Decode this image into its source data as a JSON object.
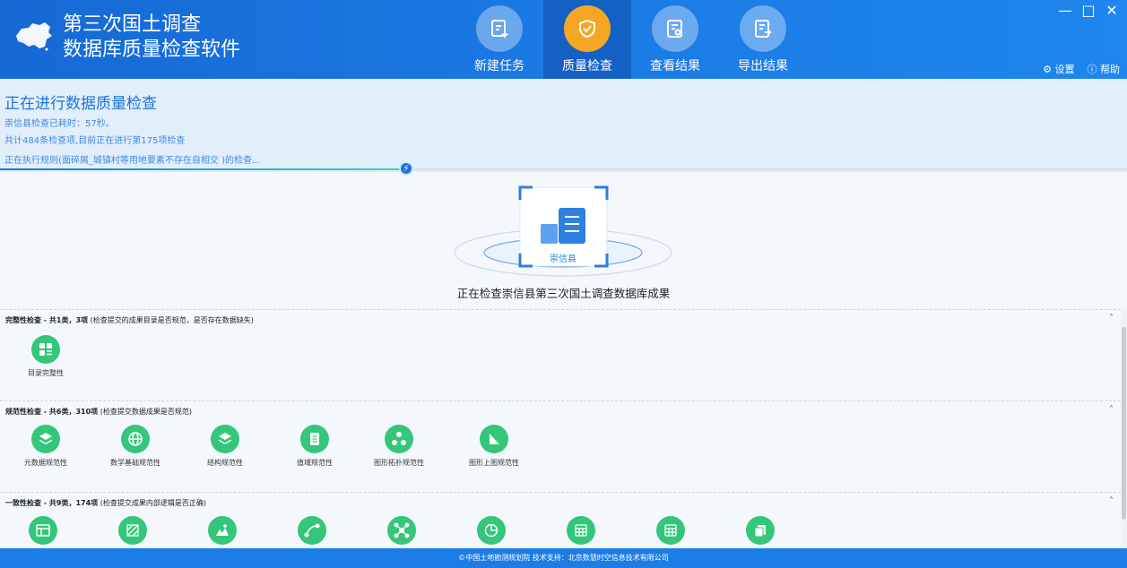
{
  "header": {
    "title_line1": "第三次国土调查",
    "title_line2": "数据库质量检查软件",
    "settings_label": "设置",
    "help_label": "帮助",
    "window_controls": [
      "—",
      "□",
      "✕"
    ]
  },
  "nav": [
    {
      "label": "新建任务",
      "icon": "new-task-icon",
      "active": false
    },
    {
      "label": "质量检查",
      "icon": "shield-check-icon",
      "active": true
    },
    {
      "label": "查看结果",
      "icon": "view-result-icon",
      "active": false
    },
    {
      "label": "导出结果",
      "icon": "export-icon",
      "active": false
    }
  ],
  "status": {
    "title": "正在进行数据质量检查",
    "elapsed": "崇信县检查已耗时：57秒。",
    "count": "共计484条检查项,目前正在进行第175项检查",
    "rule": "正在执行规则(面碎屑_城镇村等用地要素不存在自相交 )的检查...",
    "progress_fraction": 0.36
  },
  "county": {
    "name": "崇信县",
    "caption": "正在检查崇信县第三次国土调查数据库成果"
  },
  "panels": [
    {
      "title_bold": "完整性检查 - 共1类，3项",
      "title_note": " (检查提交的成果目录是否规范，是否存在数据缺失)",
      "collapse": "˄",
      "items": [
        {
          "label": "目录完整性",
          "icon": "catalog-icon"
        }
      ]
    },
    {
      "title_bold": "规范性检查 - 共6类，310项",
      "title_note": " (检查提交数据成果是否规范)",
      "collapse": "˄",
      "items": [
        {
          "label": "元数据规范性",
          "icon": "layers-icon"
        },
        {
          "label": "数学基础规范性",
          "icon": "globe-icon"
        },
        {
          "label": "结构规范性",
          "icon": "layers-icon"
        },
        {
          "label": "值域规范性",
          "icon": "document-icon"
        },
        {
          "label": "图形拓扑规范性",
          "icon": "topology-icon"
        },
        {
          "label": "图形上图规范性",
          "icon": "triangle-icon"
        }
      ]
    },
    {
      "title_bold": "一致性检查 - 共9类，174项",
      "title_note": " (检查提交成果内部逻辑是否正确)",
      "collapse": "˄",
      "items": [
        {
          "label": "",
          "icon": "table-icon"
        },
        {
          "label": "",
          "icon": "hatch-icon"
        },
        {
          "label": "",
          "icon": "map-icon"
        },
        {
          "label": "",
          "icon": "vector-icon"
        },
        {
          "label": "",
          "icon": "network-icon"
        },
        {
          "label": "",
          "icon": "pie-icon"
        },
        {
          "label": "",
          "icon": "grid-icon"
        },
        {
          "label": "",
          "icon": "grid-icon"
        },
        {
          "label": "",
          "icon": "copy-icon"
        }
      ]
    }
  ],
  "footer": {
    "text": "©中国土地勘测规划院    技术支持：北京数慧时空信息技术有限公司"
  }
}
